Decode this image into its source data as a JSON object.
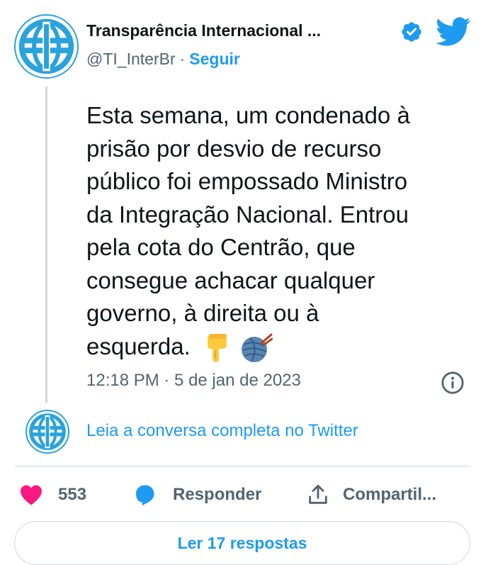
{
  "tweet": {
    "author_name": "Transparência Internacional ...",
    "handle": "@TI_InterBr",
    "separator": "·",
    "follow_label": "Seguir",
    "text_lines": [
      "Esta semana, um condenado à",
      "prisão por desvio de recurso",
      "público foi empossado Ministro",
      "da Integração Nacional. Entrou",
      "pela cota do Centrão, que",
      "consegue achacar qualquer",
      "governo, à direita ou à",
      "esquerda."
    ],
    "emojis": [
      "pointing-down-hand",
      "yarn-ball"
    ],
    "timestamp": "12:18 PM · 5 de jan de 2023"
  },
  "conversation": {
    "link_label": "Leia a conversa completa no Twitter"
  },
  "actions": {
    "like_count": "553",
    "reply_label": "Responder",
    "share_label": "Compartil..."
  },
  "replies_button_label": "Ler 17 respostas",
  "colors": {
    "accent": "#1d9bf0",
    "like": "#f91880",
    "text": "#0f1419",
    "muted": "#536471",
    "border": "#cfd9de",
    "brand_ti": "#2aa3dc"
  },
  "icons": [
    "transparency-international-logo",
    "verified-badge-icon",
    "twitter-bird-icon",
    "info-icon",
    "heart-icon",
    "reply-bubble-icon",
    "share-icon"
  ]
}
